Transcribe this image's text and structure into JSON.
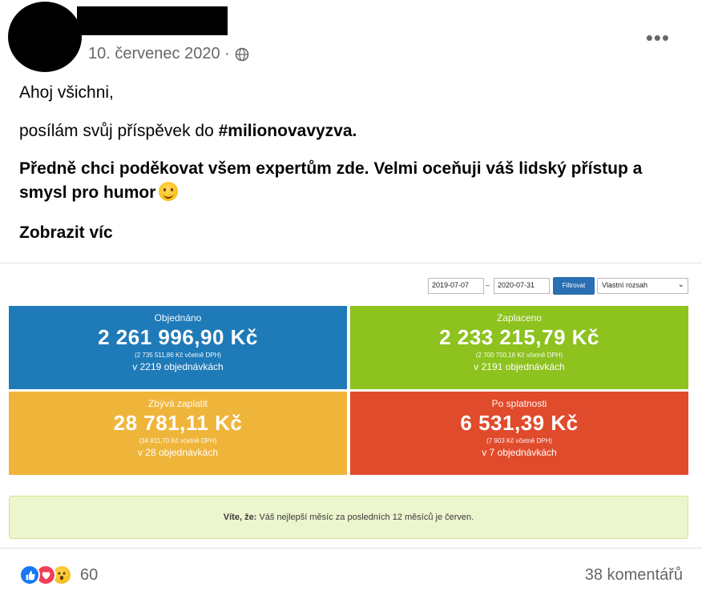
{
  "post": {
    "date": "10. červenec 2020 ·",
    "more_icon": "more-horizontal-icon",
    "audience_icon": "globe-icon",
    "lines": {
      "greeting": "Ahoj všichni,",
      "intro_prefix": "posílám svůj příspěvek do ",
      "hashtag": "#milionovavyzva.",
      "thanks": "Předně chci poděkovat všem expertům zde. Velmi oceňuji váš lidský přístup a smysl pro humor",
      "see_more": "Zobrazit víc"
    }
  },
  "attachment": {
    "filter": {
      "date_from": "2019-07-07",
      "separator": "–",
      "date_to": "2020-07-31",
      "button": "Filtrovat",
      "range_select": "Vlastní rozsah"
    },
    "tiles": {
      "ordered": {
        "label": "Objednáno",
        "amount": "2 261 996,90 Kč",
        "vat": "(2 735 511,86 Kč včetně DPH)",
        "count": "v 2219 objednávkách",
        "color": "#1f7ab8"
      },
      "paid": {
        "label": "Zaplaceno",
        "amount": "2 233 215,79 Kč",
        "vat": "(2 700 700,16 Kč včetně DPH)",
        "count": "v 2191 objednávkách",
        "color": "#8dc21f"
      },
      "remaining": {
        "label": "Zbývá zaplatit",
        "amount": "28 781,11 Kč",
        "vat": "(34 811,70 Kč včetně DPH)",
        "count": "v 28 objednávkách",
        "color": "#efb53b"
      },
      "overdue": {
        "label": "Po splatnosti",
        "amount": "6 531,39 Kč",
        "vat": "(7 903 Kč včetně DPH)",
        "count": "v 7 objednávkách",
        "color": "#e04b2c"
      }
    },
    "tip": {
      "prefix": "Víte, že:",
      "text": " Váš nejlepší měsíc za posledních 12 měsíců je červen."
    }
  },
  "footer": {
    "reaction_icons": [
      "like-icon",
      "love-icon",
      "wow-icon"
    ],
    "reaction_count": "60",
    "comments": "38 komentářů"
  }
}
